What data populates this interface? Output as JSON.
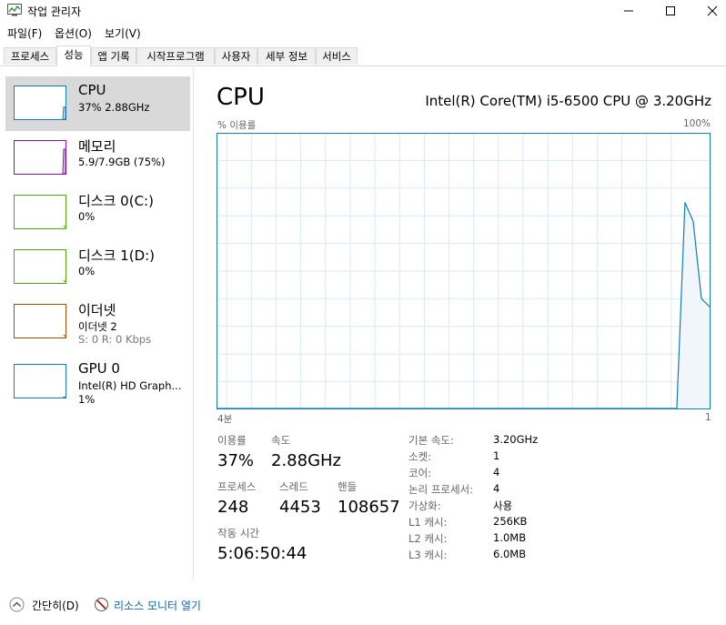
{
  "window": {
    "title": "작업 관리자"
  },
  "menu": [
    "파일(F)",
    "옵션(O)",
    "보기(V)"
  ],
  "tabs": [
    {
      "label": "프로세스",
      "active": false
    },
    {
      "label": "성능",
      "active": true
    },
    {
      "label": "앱 기록",
      "active": false
    },
    {
      "label": "시작프로그램",
      "active": false
    },
    {
      "label": "사용자",
      "active": false
    },
    {
      "label": "세부 정보",
      "active": false
    },
    {
      "label": "서비스",
      "active": false
    }
  ],
  "sidebar": [
    {
      "name": "CPU",
      "lines": [
        "37% 2.88GHz"
      ],
      "color": "#117dbb",
      "selected": true,
      "usage": 0.37
    },
    {
      "name": "메모리",
      "lines": [
        "5.9/7.9GB (75%)"
      ],
      "color": "#8b12ae",
      "selected": false,
      "usage": 0.75
    },
    {
      "name": "디스크 0(C:)",
      "lines": [
        "0%"
      ],
      "color": "#4da60c",
      "selected": false,
      "usage": 0.0
    },
    {
      "name": "디스크 1(D:)",
      "lines": [
        "0%"
      ],
      "color": "#4da60c",
      "selected": false,
      "usage": 0.0
    },
    {
      "name": "이더넷",
      "lines": [
        "이더넷 2",
        "S: 0 R: 0 Kbps"
      ],
      "color": "#a74f01",
      "selected": false,
      "usage": 0.0
    },
    {
      "name": "GPU 0",
      "lines": [
        "Intel(R) HD Graph...",
        "1%"
      ],
      "color": "#117dbb",
      "selected": false,
      "usage": 0.01
    }
  ],
  "main": {
    "title": "CPU",
    "model": "Intel(R) Core(TM) i5-6500 CPU @ 3.20GHz",
    "graph_label": "% 이용률",
    "graph_max": "100%",
    "graph_time_left": "4분",
    "graph_time_right": "1"
  },
  "stats": {
    "usage_label": "이용률",
    "usage": "37%",
    "speed_label": "속도",
    "speed": "2.88GHz",
    "processes_label": "프로세스",
    "processes": "248",
    "threads_label": "스레드",
    "threads": "4453",
    "handles_label": "핸들",
    "handles": "108657",
    "uptime_label": "작동 시간",
    "uptime": "5:06:50:44"
  },
  "specs": [
    {
      "label": "기본 속도:",
      "value": "3.20GHz"
    },
    {
      "label": "소켓:",
      "value": "1"
    },
    {
      "label": "코어:",
      "value": "4"
    },
    {
      "label": "논리 프로세서:",
      "value": "4"
    },
    {
      "label": "가상화:",
      "value": "사용"
    },
    {
      "label": "L1 캐시:",
      "value": "256KB"
    },
    {
      "label": "L2 캐시:",
      "value": "1.0MB"
    },
    {
      "label": "L3 캐시:",
      "value": "6.0MB"
    }
  ],
  "footer": {
    "collapse_label": "간단히(D)",
    "resmon_label": "리소스 모니터 열기"
  },
  "chart_data": {
    "type": "area",
    "x": [
      0,
      56,
      57,
      58,
      59,
      60
    ],
    "values": [
      0,
      0,
      75,
      68,
      40,
      37
    ],
    "ylim": [
      0,
      100
    ],
    "xlim": [
      0,
      60
    ],
    "grid": true,
    "color": "#117dbb"
  }
}
